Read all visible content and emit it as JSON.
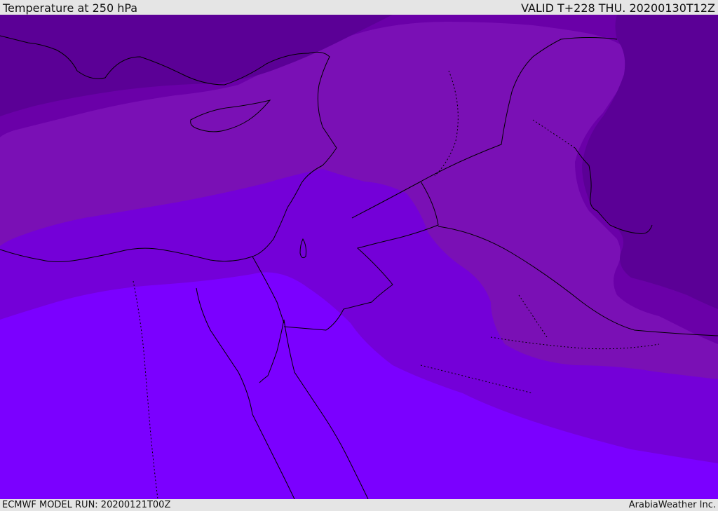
{
  "header": {
    "title": "Temperature at 250 hPa",
    "valid_time": "VALID T+228 THU. 20200130T12Z"
  },
  "footer": {
    "model_run": "ECMWF MODEL RUN: 20200121T00Z",
    "credit": "ArabiaWeather Inc."
  },
  "colors": {
    "band_coldest": "#5b0096",
    "band_cold": "#6a00a8",
    "band_mid": "#7a10b5",
    "band_warm": "#7400d8",
    "band_warmest": "#7b00ff",
    "coastline": "#000000"
  }
}
